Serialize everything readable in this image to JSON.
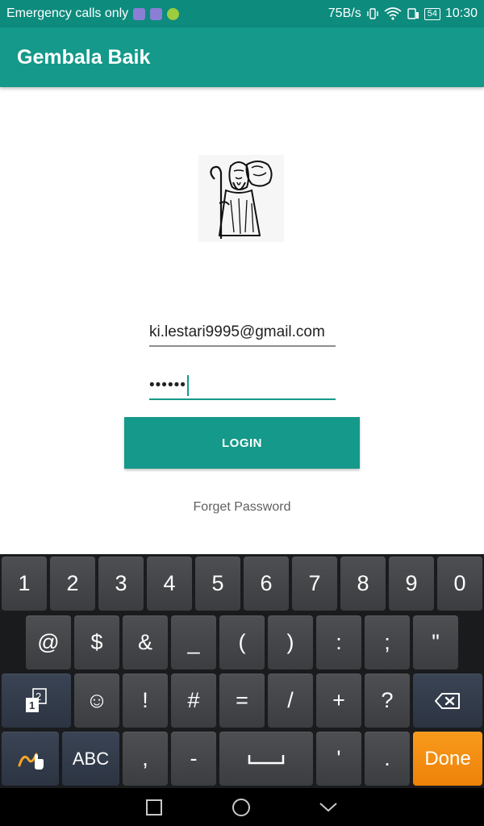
{
  "status_bar": {
    "carrier_text": "Emergency calls only",
    "net_speed": "75B/s",
    "battery": "54",
    "time": "10:30"
  },
  "app_bar": {
    "title": "Gembala Baik"
  },
  "logo": {
    "icon": "shepherd-with-lamb-image"
  },
  "login": {
    "email_value": "ki.lestari9995@gmail.com",
    "password_value": "••••••",
    "login_label": "LOGIN",
    "forget_label": "Forget Password"
  },
  "keyboard": {
    "row1": [
      "1",
      "2",
      "3",
      "4",
      "5",
      "6",
      "7",
      "8",
      "9",
      "0"
    ],
    "row2": [
      "@",
      "$",
      "&",
      "_",
      "(",
      ")",
      ":",
      ";",
      "\""
    ],
    "row3": [
      "☺",
      "!",
      "#",
      "=",
      "/",
      "+",
      "?"
    ],
    "abc_label": "ABC",
    "comma": ",",
    "dash": "-",
    "apostrophe": "'",
    "period": ".",
    "done_label": "Done"
  },
  "colors": {
    "primary": "#14998a",
    "primary_dark": "#0d8b7d",
    "done": "#f48a10"
  }
}
